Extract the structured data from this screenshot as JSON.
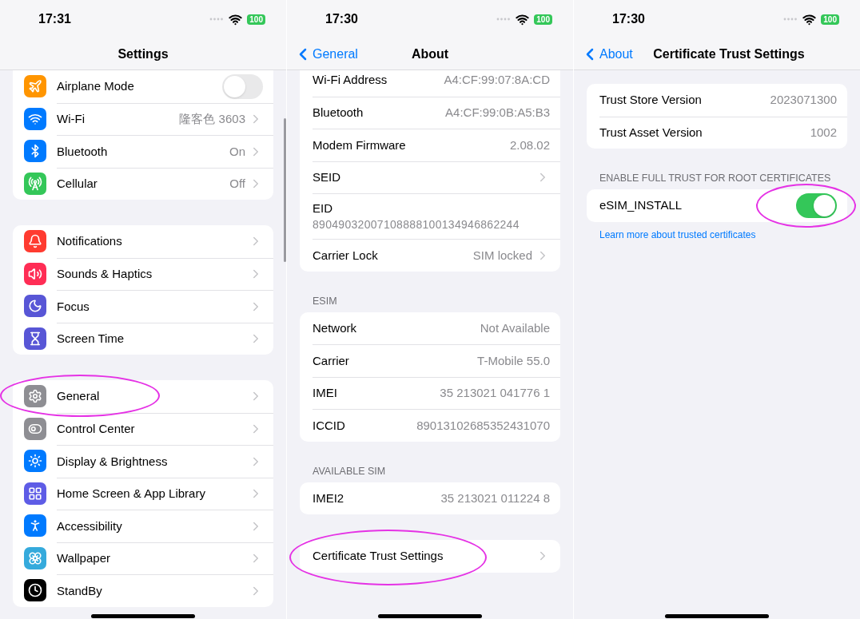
{
  "panels": [
    {
      "status_bar": {
        "time": "17:31",
        "battery": "100"
      },
      "nav": {
        "title": "Settings"
      },
      "groups": [
        {
          "rows": [
            {
              "label": "Airplane Mode",
              "kind": "toggle",
              "on": false
            },
            {
              "label": "Wi-Fi",
              "value": "隆客色 3603",
              "kind": "link"
            },
            {
              "label": "Bluetooth",
              "value": "On",
              "kind": "link"
            },
            {
              "label": "Cellular",
              "value": "Off",
              "kind": "link"
            }
          ]
        },
        {
          "rows": [
            {
              "label": "Notifications",
              "kind": "link"
            },
            {
              "label": "Sounds & Haptics",
              "kind": "link"
            },
            {
              "label": "Focus",
              "kind": "link"
            },
            {
              "label": "Screen Time",
              "kind": "link"
            }
          ]
        },
        {
          "rows": [
            {
              "label": "General",
              "kind": "link",
              "circled": true
            },
            {
              "label": "Control Center",
              "kind": "link"
            },
            {
              "label": "Display & Brightness",
              "kind": "link"
            },
            {
              "label": "Home Screen & App Library",
              "kind": "link"
            },
            {
              "label": "Accessibility",
              "kind": "link"
            },
            {
              "label": "Wallpaper",
              "kind": "link"
            },
            {
              "label": "StandBy",
              "kind": "link"
            }
          ]
        }
      ]
    },
    {
      "status_bar": {
        "time": "17:30",
        "battery": "100"
      },
      "nav": {
        "back": "General",
        "title": "About"
      },
      "groups": [
        {
          "rows": [
            {
              "label": "Wi-Fi Address",
              "value": "A4:CF:99:07:8A:CD",
              "kind": "info"
            },
            {
              "label": "Bluetooth",
              "value": "A4:CF:99:0B:A5:B3",
              "kind": "info"
            },
            {
              "label": "Modem Firmware",
              "value": "2.08.02",
              "kind": "info"
            },
            {
              "label": "SEID",
              "kind": "link"
            },
            {
              "label": "EID",
              "value": "89049032007108888100134946862244",
              "kind": "stacked"
            },
            {
              "label": "Carrier Lock",
              "value": "SIM locked",
              "kind": "link"
            }
          ]
        },
        {
          "header": "ESIM",
          "rows": [
            {
              "label": "Network",
              "value": "Not Available",
              "kind": "info"
            },
            {
              "label": "Carrier",
              "value": "T-Mobile 55.0",
              "kind": "info"
            },
            {
              "label": "IMEI",
              "value": "35 213021 041776 1",
              "kind": "info"
            },
            {
              "label": "ICCID",
              "value": "89013102685352431070",
              "kind": "info"
            }
          ]
        },
        {
          "header": "AVAILABLE SIM",
          "rows": [
            {
              "label": "IMEI2",
              "value": "35 213021 011224 8",
              "kind": "info"
            }
          ]
        },
        {
          "rows": [
            {
              "label": "Certificate Trust Settings",
              "kind": "link",
              "circled": true
            }
          ]
        }
      ]
    },
    {
      "status_bar": {
        "time": "17:30",
        "battery": "100"
      },
      "nav": {
        "back": "About",
        "title": "Certificate Trust Settings"
      },
      "groups": [
        {
          "rows": [
            {
              "label": "Trust Store Version",
              "value": "2023071300",
              "kind": "info"
            },
            {
              "label": "Trust Asset Version",
              "value": "1002",
              "kind": "info"
            }
          ]
        },
        {
          "header": "ENABLE FULL TRUST FOR ROOT CERTIFICATES",
          "rows": [
            {
              "label": "eSIM_INSTALL",
              "kind": "toggle",
              "on": true,
              "circled": true
            }
          ],
          "footer_link": "Learn more about trusted certificates"
        }
      ]
    }
  ]
}
